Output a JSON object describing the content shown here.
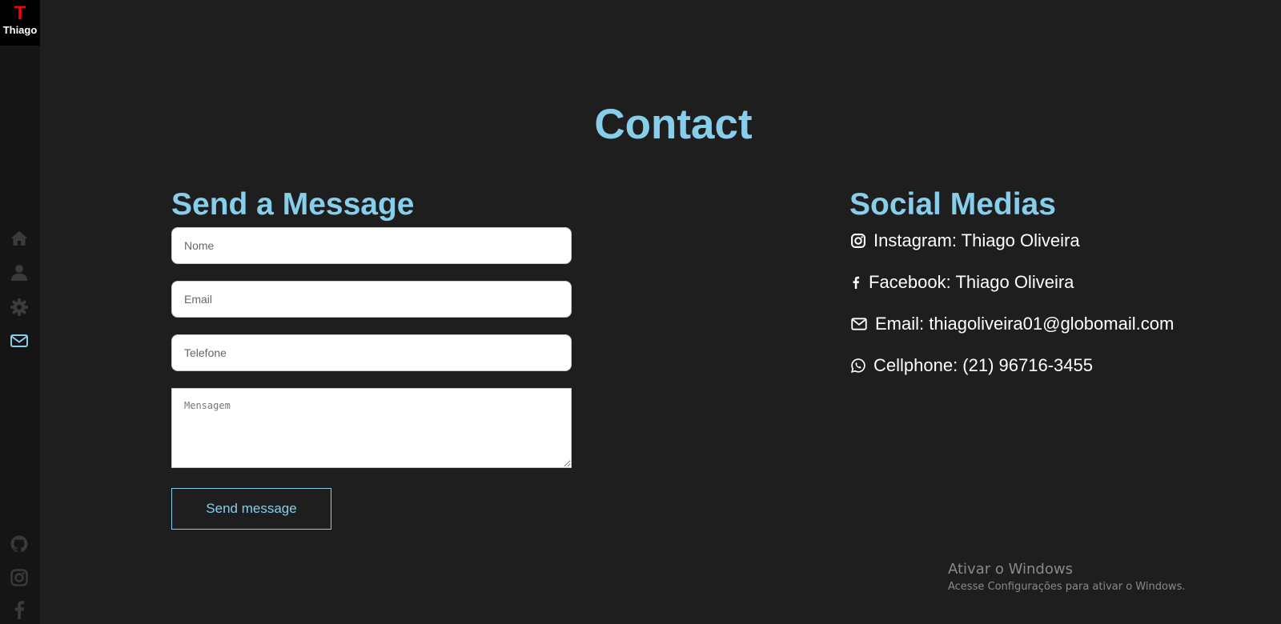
{
  "sidebar": {
    "logo_letter": "T",
    "logo_name": "Thiago",
    "nav": [
      {
        "icon": "home-icon"
      },
      {
        "icon": "user-icon"
      },
      {
        "icon": "gear-icon"
      },
      {
        "icon": "envelope-icon",
        "active": true
      }
    ],
    "social": [
      {
        "icon": "github-icon"
      },
      {
        "icon": "instagram-icon"
      },
      {
        "icon": "facebook-icon"
      }
    ],
    "active_color": "#87ceeb",
    "inactive_color": "#3a3a3a"
  },
  "page": {
    "title": "Contact",
    "accent_color": "#87ceeb"
  },
  "form": {
    "title": "Send a Message",
    "name_placeholder": "Nome",
    "email_placeholder": "Email",
    "phone_placeholder": "Telefone",
    "message_placeholder": "Mensagem",
    "submit_label": "Send message"
  },
  "social": {
    "title": "Social Medias",
    "items": [
      {
        "icon": "instagram-icon",
        "text": "Instagram: Thiago Oliveira"
      },
      {
        "icon": "facebook-icon",
        "text": "Facebook: Thiago Oliveira"
      },
      {
        "icon": "envelope-icon",
        "text": "Email: thiagoliveira01@globomail.com"
      },
      {
        "icon": "whatsapp-icon",
        "text": "Cellphone: (21) 96716-3455"
      }
    ]
  },
  "watermark": {
    "title": "Ativar o Windows",
    "subtitle": "Acesse Configurações para ativar o Windows."
  }
}
